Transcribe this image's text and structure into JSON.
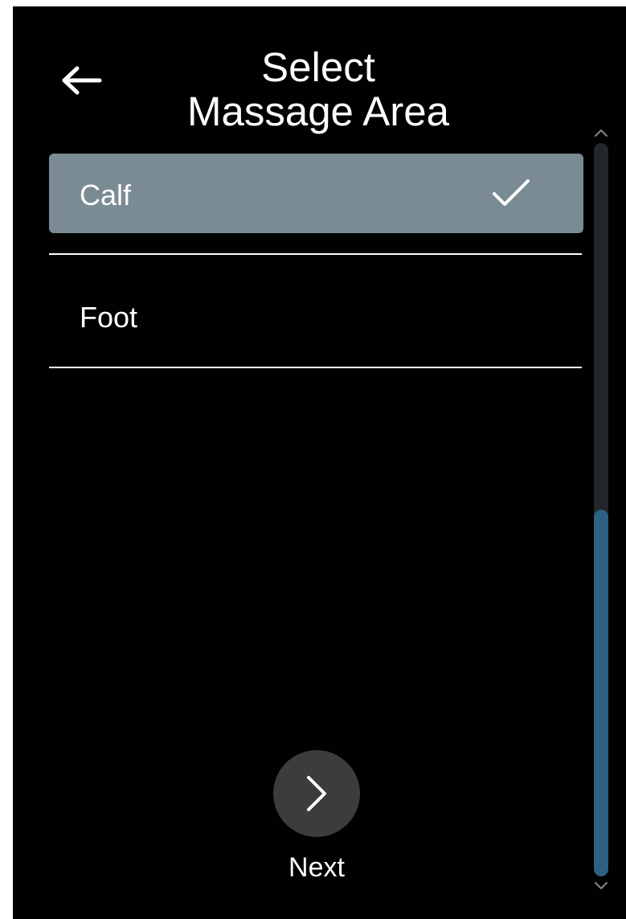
{
  "header": {
    "back_icon": "arrow-left-icon",
    "title_line1": "Select",
    "title_line2": "Massage Area"
  },
  "options": [
    {
      "label": "Calf",
      "selected": true,
      "icon": "checkmark-icon"
    },
    {
      "label": "Foot",
      "selected": false
    }
  ],
  "scrollbar": {
    "up_icon": "chevron-up-icon",
    "down_icon": "chevron-down-icon",
    "position_fraction": 0.5
  },
  "footer": {
    "next_icon": "chevron-right-icon",
    "next_label": "Next"
  },
  "colors": {
    "background": "#010101",
    "selected_item": "#7a8b93",
    "scroll_track": "#21272c",
    "scroll_thumb": "#2c6183",
    "next_button": "#3a3c3e",
    "text": "#ffffff"
  }
}
